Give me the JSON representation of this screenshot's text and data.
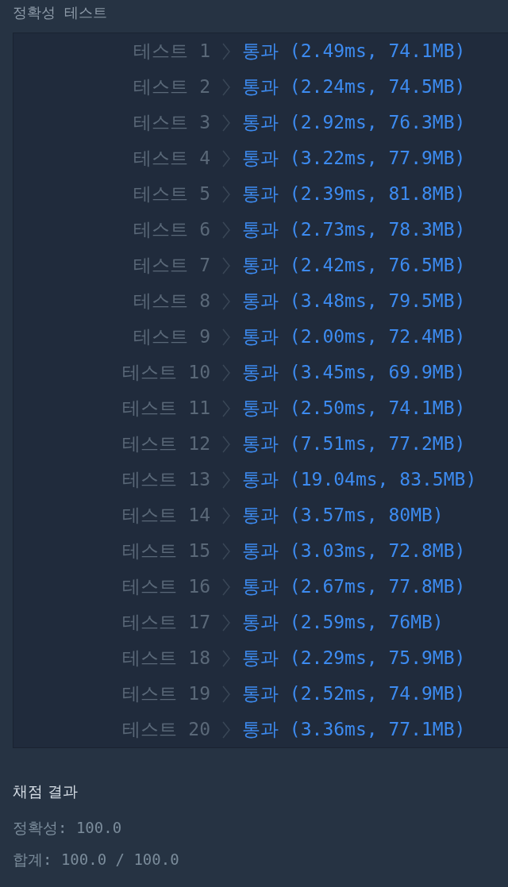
{
  "section_title": "정확성  테스트",
  "tests": [
    {
      "label": "테스트 1",
      "result": "통과 (2.49ms, 74.1MB)"
    },
    {
      "label": "테스트 2",
      "result": "통과 (2.24ms, 74.5MB)"
    },
    {
      "label": "테스트 3",
      "result": "통과 (2.92ms, 76.3MB)"
    },
    {
      "label": "테스트 4",
      "result": "통과 (3.22ms, 77.9MB)"
    },
    {
      "label": "테스트 5",
      "result": "통과 (2.39ms, 81.8MB)"
    },
    {
      "label": "테스트 6",
      "result": "통과 (2.73ms, 78.3MB)"
    },
    {
      "label": "테스트 7",
      "result": "통과 (2.42ms, 76.5MB)"
    },
    {
      "label": "테스트 8",
      "result": "통과 (3.48ms, 79.5MB)"
    },
    {
      "label": "테스트 9",
      "result": "통과 (2.00ms, 72.4MB)"
    },
    {
      "label": "테스트 10",
      "result": "통과 (3.45ms, 69.9MB)"
    },
    {
      "label": "테스트 11",
      "result": "통과 (2.50ms, 74.1MB)"
    },
    {
      "label": "테스트 12",
      "result": "통과 (7.51ms, 77.2MB)"
    },
    {
      "label": "테스트 13",
      "result": "통과 (19.04ms, 83.5MB)"
    },
    {
      "label": "테스트 14",
      "result": "통과 (3.57ms, 80MB)"
    },
    {
      "label": "테스트 15",
      "result": "통과 (3.03ms, 72.8MB)"
    },
    {
      "label": "테스트 16",
      "result": "통과 (2.67ms, 77.8MB)"
    },
    {
      "label": "테스트 17",
      "result": "통과 (2.59ms, 76MB)"
    },
    {
      "label": "테스트 18",
      "result": "통과 (2.29ms, 75.9MB)"
    },
    {
      "label": "테스트 19",
      "result": "통과 (2.52ms, 74.9MB)"
    },
    {
      "label": "테스트 20",
      "result": "통과 (3.36ms, 77.1MB)"
    }
  ],
  "grading": {
    "title": "채점 결과",
    "lines": [
      "정확성: 100.0",
      "합계: 100.0 / 100.0"
    ]
  }
}
